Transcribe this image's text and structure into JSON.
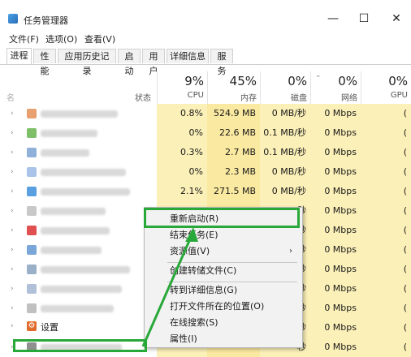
{
  "window": {
    "title": "任务管理器",
    "min": "—",
    "max": "☐",
    "close": "✕"
  },
  "menu": [
    "文件(F)",
    "选项(O)",
    "查看(V)"
  ],
  "tabs": [
    "进程",
    "性能",
    "应用历史记录",
    "启动",
    "用户",
    "详细信息",
    "服务"
  ],
  "columns": {
    "name_partial": "名",
    "status": "状态",
    "cpu": {
      "pct": "9%",
      "label": "CPU"
    },
    "mem": {
      "pct": "45%",
      "label": "内存"
    },
    "disk": {
      "pct": "0%",
      "label": "磁盘"
    },
    "net": {
      "pct": "0%",
      "label": "网络"
    },
    "gpu": {
      "pct": "0%",
      "label": "GPU"
    }
  },
  "rows": [
    {
      "cpu": "0.8%",
      "mem": "524.9 MB",
      "disk": "0 MB/秒",
      "net": "0 Mbps",
      "gpu": "("
    },
    {
      "cpu": "0%",
      "mem": "22.6 MB",
      "disk": "0.1 MB/秒",
      "net": "0 Mbps",
      "gpu": "("
    },
    {
      "cpu": "0.3%",
      "mem": "2.7 MB",
      "disk": "0.1 MB/秒",
      "net": "0 Mbps",
      "gpu": "("
    },
    {
      "cpu": "0%",
      "mem": "2.3 MB",
      "disk": "0 MB/秒",
      "net": "0 Mbps",
      "gpu": "("
    },
    {
      "cpu": "2.1%",
      "mem": "271.5 MB",
      "disk": "0 MB/秒",
      "net": "0 Mbps",
      "gpu": "("
    },
    {
      "cpu": "",
      "mem": "",
      "disk": "秒",
      "net": "0 Mbps",
      "gpu": "("
    },
    {
      "cpu": "",
      "mem": "",
      "disk": "秒",
      "net": "0 Mbps",
      "gpu": "("
    },
    {
      "cpu": "",
      "mem": "",
      "disk": "秒",
      "net": "0 Mbps",
      "gpu": "("
    },
    {
      "cpu": "",
      "mem": "",
      "disk": "秒",
      "net": "0 Mbps",
      "gpu": "("
    },
    {
      "cpu": "",
      "mem": "",
      "disk": "秒",
      "net": "0 Mbps",
      "gpu": "("
    },
    {
      "cpu": "",
      "mem": "",
      "disk": "秒",
      "net": "0 Mbps",
      "gpu": "("
    },
    {
      "cpu": "",
      "mem": "",
      "disk": "秒",
      "net": "0 Mbps",
      "gpu": "("
    },
    {
      "cpu": "",
      "mem": "",
      "disk": "秒",
      "net": "0 Mbps",
      "gpu": "("
    }
  ],
  "settings_row_label": "设置",
  "context_menu": {
    "items": [
      "重新启动(R)",
      "结束任务(E)",
      "资源值(V)",
      "创建转储文件(C)",
      "转到详细信息(G)",
      "打开文件所在的位置(O)",
      "在线搜索(S)",
      "属性(I)"
    ],
    "submenu_arrow": "›"
  },
  "colors": {
    "highlight": "#29a83a",
    "cpu_fill": "#fbf0b8",
    "mem_fill": "#fae9a0"
  }
}
